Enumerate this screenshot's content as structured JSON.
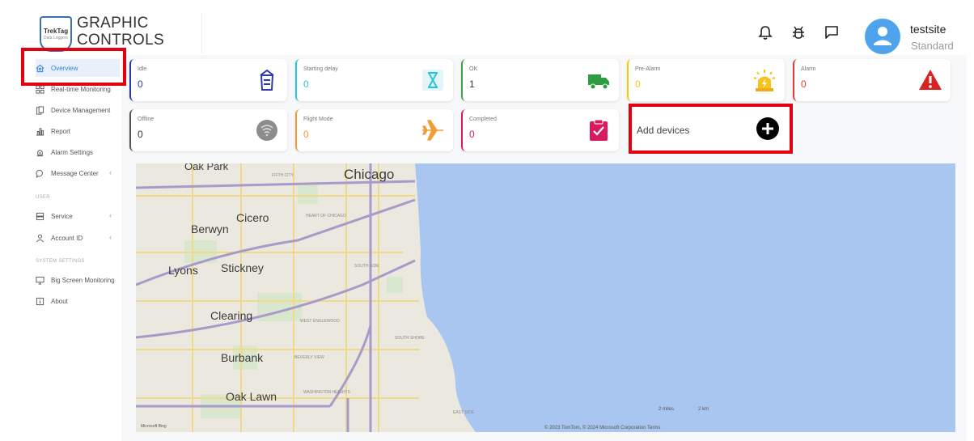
{
  "header": {
    "logo_line1": "GRAPHIC",
    "logo_line2": "CONTROLS",
    "logo_badge": "TrekTag",
    "logo_badge_sub": "Data Loggers",
    "user_name": "testsite",
    "user_role": "Standard",
    "icons": [
      "bell-icon",
      "bug-icon",
      "message-icon",
      "user-avatar-icon"
    ]
  },
  "sidebar": {
    "items": [
      {
        "label": "Overview",
        "icon": "home-icon",
        "active": true
      },
      {
        "label": "Real-time Monitoring",
        "icon": "grid-icon"
      },
      {
        "label": "Device Management",
        "icon": "devices-icon"
      },
      {
        "label": "Report",
        "icon": "chart-icon"
      },
      {
        "label": "Alarm Settings",
        "icon": "alarm-icon"
      },
      {
        "label": "Message Center",
        "icon": "chat-icon",
        "chevron": "‹"
      },
      {
        "label": "Service",
        "icon": "server-icon",
        "chevron": "‹"
      },
      {
        "label": "Account ID",
        "icon": "person-icon",
        "chevron": "‹"
      },
      {
        "label": "Big Screen Monitoring",
        "icon": "monitor-icon",
        "chevron": "‹"
      },
      {
        "label": "About",
        "icon": "info-icon"
      }
    ],
    "sections": {
      "user": "USER",
      "system": "SYSTEM SETTINGS"
    }
  },
  "status_cards": [
    {
      "label": "Idle",
      "value": "0",
      "color": "#2b3aa8",
      "icon": "shopping-bag-icon"
    },
    {
      "label": "Starting delay",
      "value": "0",
      "color": "#26c6da",
      "icon": "hourglass-icon"
    },
    {
      "label": "OK",
      "value": "1",
      "color": "#43a047",
      "icon": "truck-icon"
    },
    {
      "label": "Pre-Alarm",
      "value": "0",
      "color": "#f9c80e",
      "icon": "siren-icon"
    },
    {
      "label": "Alarm",
      "value": "0",
      "color": "#e53935",
      "icon": "warning-icon"
    },
    {
      "label": "Offline",
      "value": "0",
      "color": "#555555",
      "icon": "wifi-off-icon"
    },
    {
      "label": "Flight Mode",
      "value": "0",
      "color": "#f39c34",
      "icon": "airplane-icon"
    },
    {
      "label": "Completed",
      "value": "0",
      "color": "#d81b60",
      "icon": "clipboard-check-icon"
    }
  ],
  "add_devices": {
    "label": "Add devices",
    "icon": "plus-circle-icon"
  },
  "map": {
    "places": [
      "Oak Park",
      "Chicago",
      "Cicero",
      "Berwyn",
      "Lyons",
      "Stickney",
      "Clearing",
      "Burbank",
      "Oak Lawn"
    ],
    "small_labels": [
      "HEART OF CHICAGO",
      "SOUTH SIDE",
      "WEST ENGLEWOOD",
      "SOUTH SHORE",
      "BEVERLY VIEW",
      "WASHINGTON HEIGHTS",
      "FIFTH CITY",
      "EAST SIDE"
    ],
    "scale": [
      "2 miles",
      "2 km"
    ],
    "attribution": "© 2023 TomTom, © 2024 Microsoft Corporation  Terms",
    "brand": "Microsoft Bing",
    "water_color": "#a9c6f0",
    "land_color": "#ebe8df"
  }
}
